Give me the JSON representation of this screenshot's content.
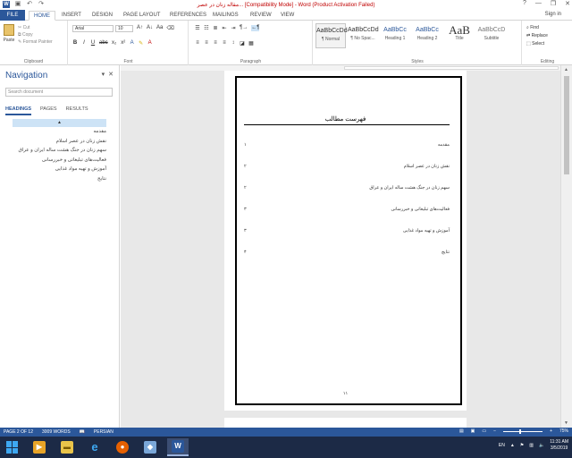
{
  "titlebar": {
    "title": "مقاله زنان در عصر... [Compatibility Mode] - Word (Product Activation Failed)",
    "word_icon": "W",
    "qat": [
      "save-icon",
      "undo-icon",
      "redo-icon"
    ],
    "controls": [
      "?",
      "—",
      "❐",
      "✕"
    ]
  },
  "tabs": {
    "file": "FILE",
    "home": "HOME",
    "insert": "INSERT",
    "design": "DESIGN",
    "page_layout": "PAGE LAYOUT",
    "references": "REFERENCES",
    "mailings": "MAILINGS",
    "review": "REVIEW",
    "view": "VIEW",
    "signin": "Sign in"
  },
  "ribbon": {
    "clipboard": {
      "paste": "Paste",
      "cut": "Cut",
      "copy": "Copy",
      "format_painter": "Format Painter",
      "label": "Clipboard"
    },
    "font": {
      "name": "Arial",
      "size": "10",
      "label": "Font"
    },
    "paragraph": {
      "label": "Paragraph"
    },
    "styles": {
      "label": "Styles",
      "items": [
        {
          "sample": "AaBbCcDd",
          "name": "¶ Normal"
        },
        {
          "sample": "AaBbCcDd",
          "name": "¶ No Spac..."
        },
        {
          "sample": "AaBbCc",
          "name": "Heading 1"
        },
        {
          "sample": "AaBbCc",
          "name": "Heading 2"
        },
        {
          "sample": "AaB",
          "name": "Title"
        },
        {
          "sample": "AaBbCcD",
          "name": "Subtitle"
        }
      ]
    },
    "editing": {
      "label": "Editing",
      "find": "Find",
      "replace": "Replace",
      "select": "Select"
    }
  },
  "navigation": {
    "title": "Navigation",
    "search_placeholder": "Search document",
    "tabs": [
      "HEADINGS",
      "PAGES",
      "RESULTS"
    ],
    "collapse_glyph": "▲",
    "headings": [
      "مقدمه",
      "نقش زنان در عصر اسلام",
      "سهم زنان در جنگ هشت ساله ایران و عراق",
      "فعالیت‌های تبلیغاتی و خبررسانی",
      "آموزش و تهیه مواد غذایی",
      "نتایج"
    ]
  },
  "document": {
    "toc_title": "فهرست مطالب",
    "toc_entries": [
      {
        "text": "مقدمه",
        "page": "۱"
      },
      {
        "text": "نقش زنان در عصر اسلام",
        "page": "۲"
      },
      {
        "text": "سهم زنان در جنگ هشت ساله ایران و عراق",
        "page": "۲"
      },
      {
        "text": "فعالیت‌های تبلیغاتی و خبررسانی",
        "page": "۳"
      },
      {
        "text": "آموزش و تهیه مواد غذایی",
        "page": "۳"
      },
      {
        "text": "نتایج",
        "page": "۴"
      }
    ],
    "footer_page": "۱۱"
  },
  "statusbar": {
    "page": "PAGE 2 OF 12",
    "words": "3009 WORDS",
    "proofing_icon": "proofing-icon",
    "language": "PERSIAN",
    "zoom": "75%"
  },
  "taskbar": {
    "tray_lang": "EN",
    "time": "11:31 AM",
    "date": "3/5/2019"
  },
  "colors": {
    "word_blue": "#2b579a",
    "taskbar": "#1c2a46",
    "title_red": "#c00000"
  }
}
